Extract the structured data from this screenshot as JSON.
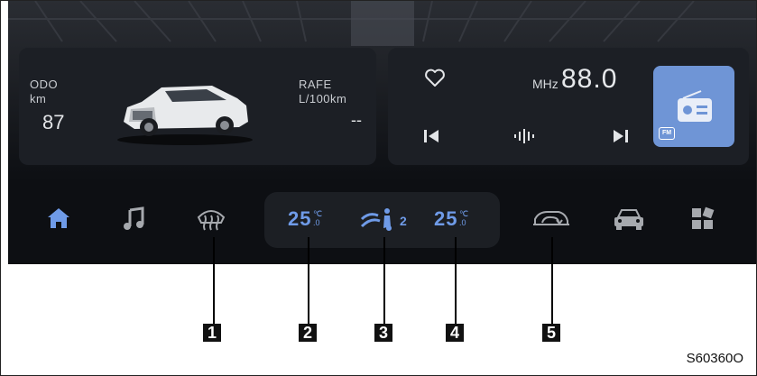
{
  "vehicle_card": {
    "odo_label": "ODO",
    "odo_unit": "km",
    "odo_value": "87",
    "rafe_label": "RAFE",
    "rafe_unit": "L/100km",
    "rafe_value": "--"
  },
  "media_card": {
    "unit": "MHz",
    "frequency": "88.0",
    "band_badge": "FM"
  },
  "climate": {
    "left_temp": "25",
    "right_temp": "25",
    "temp_unit": "℃",
    "temp_decimal": ".0",
    "fan_level": "2"
  },
  "callouts": [
    "1",
    "2",
    "3",
    "4",
    "5"
  ],
  "figure_code": "S60360O",
  "colors": {
    "accent": "#6f9be8",
    "radio_tile": "#6f95d6",
    "screen_bg": "#0d0f13",
    "card_bg": "#1c1f25"
  },
  "icons": [
    "home-icon",
    "music-icon",
    "defrost-icon",
    "fan-airflow-icon",
    "recirculation-icon",
    "car-icon",
    "apps-icon",
    "heart-icon",
    "previous-icon",
    "equalizer-icon",
    "next-icon",
    "radio-icon"
  ]
}
